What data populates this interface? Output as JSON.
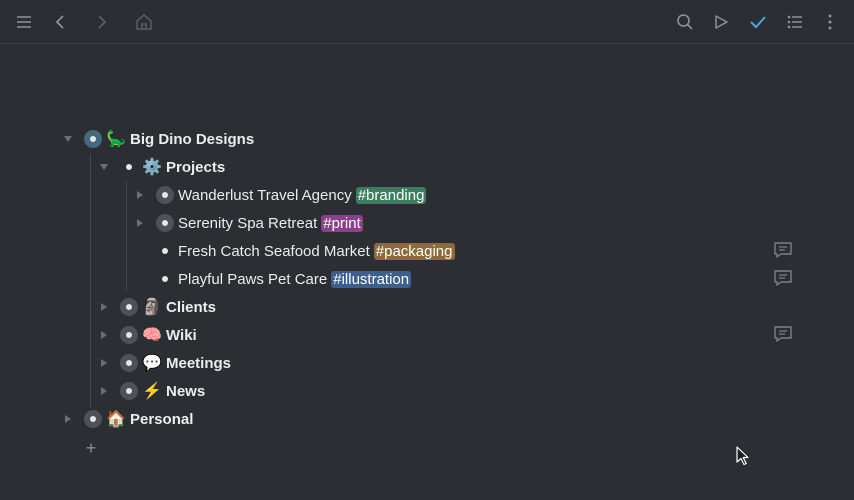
{
  "toolbar": {
    "icons": [
      "menu-icon",
      "back-arrow-icon",
      "forward-arrow-icon",
      "home-icon",
      "search-icon",
      "play-icon",
      "check-icon",
      "list-icon",
      "more-icon"
    ]
  },
  "tag_colors": {
    "branding": "#3b7d60",
    "print": "#8d3f8a",
    "packaging": "#8c6a3a",
    "illustration": "#3d5f8d"
  },
  "outline": {
    "root": {
      "emoji": "🦕",
      "label": "Big Dino Designs",
      "children": {
        "projects": {
          "emoji": "⚙️",
          "label": "Projects",
          "items": [
            {
              "label": "Wanderlust Travel Agency",
              "tag": "#branding"
            },
            {
              "label": "Serenity Spa Retreat",
              "tag": "#print"
            },
            {
              "label": "Fresh Catch Seafood Market",
              "tag": "#packaging"
            },
            {
              "label": "Playful Paws Pet Care",
              "tag": "#illustration"
            }
          ]
        },
        "clients": {
          "emoji": "🗿",
          "label": "Clients"
        },
        "wiki": {
          "emoji": "🧠",
          "label": "Wiki"
        },
        "meetings": {
          "emoji": "💬",
          "label": "Meetings"
        },
        "news": {
          "emoji": "⚡",
          "label": "News"
        }
      }
    },
    "personal": {
      "emoji": "🏠",
      "label": "Personal"
    },
    "add_symbol": "+"
  }
}
